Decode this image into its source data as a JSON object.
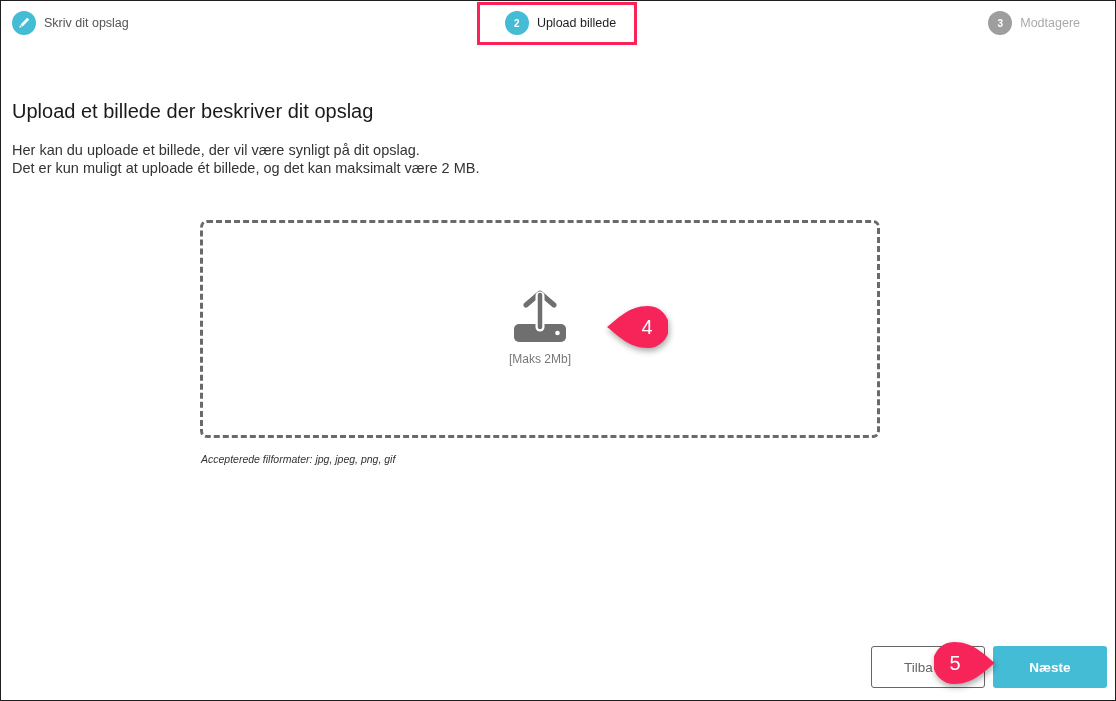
{
  "steps": [
    {
      "label": "Skriv dit opslag",
      "completed": true,
      "selected": false,
      "highlighted": false
    },
    {
      "number": "2",
      "label": "Upload billede",
      "completed": false,
      "selected": true,
      "highlighted": true
    },
    {
      "number": "3",
      "label": "Modtagere",
      "completed": false,
      "selected": false,
      "highlighted": false
    }
  ],
  "heading": "Upload et billede der beskriver dit opslag",
  "description": [
    "Her kan du uploade et billede, der vil være synligt på dit opslag.",
    "Det er kun muligt at uploade ét billede, og det kan maksimalt være 2 MB."
  ],
  "dropzone": {
    "hint": "[Maks 2Mb]",
    "callout": {
      "label": "4",
      "kind": "left"
    }
  },
  "accepted_formats": "Accepterede filformater: jpg, jpeg, png, gif",
  "buttons": [
    {
      "label": "Tilba",
      "kind": "secondary"
    },
    {
      "label": "Næste",
      "kind": "primary"
    }
  ],
  "buttons_callout": {
    "label": "5",
    "kind": "right"
  }
}
